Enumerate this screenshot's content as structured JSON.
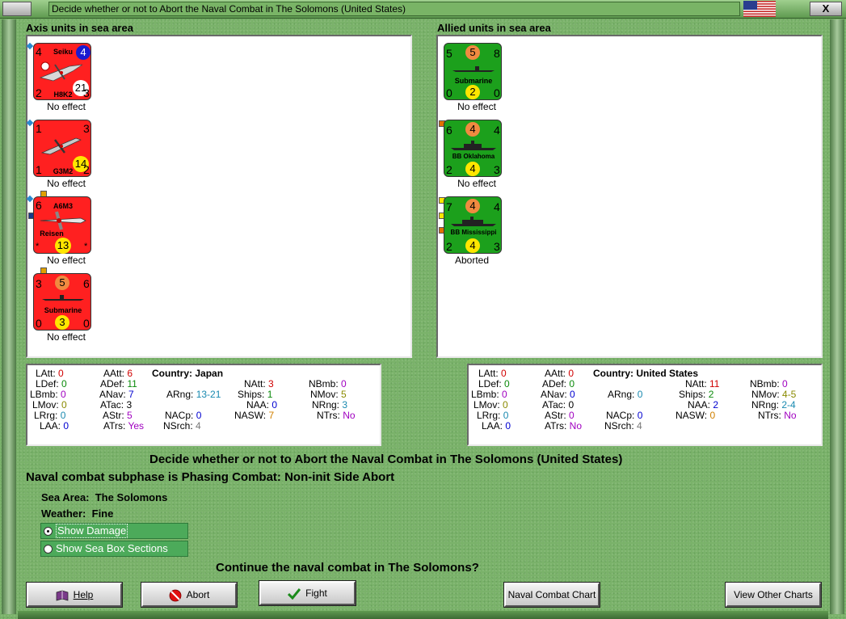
{
  "window": {
    "title": "Decide whether or not to Abort the Naval Combat in The Solomons (United States)",
    "close_label": "X",
    "flag": "us-flag-icon"
  },
  "axis": {
    "label": "Axis units in sea area",
    "units": [
      {
        "name": "Seiku",
        "model": "H8K2",
        "tl": "4",
        "tr": "4",
        "bl": "2",
        "br": "3",
        "val": "21",
        "caption": "No effect"
      },
      {
        "name": "",
        "model": "G3M2",
        "tl": "1",
        "tr": "3",
        "bl": "1",
        "br": "2",
        "val": "14",
        "caption": "No effect"
      },
      {
        "name": "A6M3",
        "model": "Reisen",
        "tl": "6",
        "tr": "",
        "bl": "*",
        "br": "*",
        "val": "13",
        "caption": "No effect"
      },
      {
        "name": "Submarine",
        "model": "",
        "tl": "3",
        "tm": "5",
        "tr": "6",
        "bl": "0",
        "bm": "3",
        "br": "0",
        "caption": "No effect"
      }
    ],
    "stats": {
      "LAtt": "0",
      "LDef": "0",
      "LBmb": "0",
      "LMov": "0",
      "LRrg": "0",
      "LAA": "0",
      "AAtt": "6",
      "ADef": "11",
      "ANav": "7",
      "ATac": "3",
      "AStr": "5",
      "ATrs": "Yes",
      "country_label": "Country:",
      "country": "Japan",
      "ARng": "13-21",
      "NACp": "0",
      "NSrch": "4",
      "NAtt": "3",
      "Ships": "1",
      "NAA": "0",
      "NASW": "7",
      "NBmb": "0",
      "NMov": "5",
      "NRng": "3",
      "NTrs": "No"
    }
  },
  "allied": {
    "label": "Allied units in sea area",
    "units": [
      {
        "name": "Submarine",
        "tl": "5",
        "tm": "5",
        "tr": "8",
        "bl": "0",
        "bm": "2",
        "br": "0",
        "caption": "No effect"
      },
      {
        "name": "BB Oklahoma",
        "tl": "6",
        "tm": "4",
        "tr": "4",
        "bl": "2",
        "bm": "4",
        "br": "3",
        "caption": "No effect"
      },
      {
        "name": "BB Mississippi",
        "tl": "7",
        "tm": "4",
        "tr": "4",
        "bl": "2",
        "bm": "4",
        "br": "3",
        "caption": "Aborted"
      }
    ],
    "stats": {
      "LAtt": "0",
      "LDef": "0",
      "LBmb": "0",
      "LMov": "0",
      "LRrg": "0",
      "LAA": "0",
      "AAtt": "0",
      "ADef": "0",
      "ANav": "0",
      "ATac": "0",
      "AStr": "0",
      "ATrs": "No",
      "country_label": "Country:",
      "country": "United States",
      "ARng": "0",
      "NACp": "0",
      "NSrch": "4",
      "NAtt": "11",
      "Ships": "2",
      "NAA": "2",
      "NASW": "0",
      "NBmb": "0",
      "NMov": "4-5",
      "NRng": "2-4",
      "NTrs": "No"
    }
  },
  "main": {
    "heading": "Decide whether or not to Abort the Naval Combat in The Solomons (United States)",
    "subphase": "Naval combat subphase is Phasing Combat: Non-init Side Abort",
    "sea_area_label": "Sea Area:",
    "sea_area": "The Solomons",
    "weather_label": "Weather:",
    "weather": "Fine",
    "show_damage": "Show Damage",
    "show_sea_box": "Show Sea Box Sections",
    "question": "Continue the naval combat in The Solomons?"
  },
  "buttons": {
    "help": "Help",
    "abort": "Abort",
    "fight": "Fight",
    "naval_chart": "Naval Combat Chart",
    "other_charts": "View Other Charts"
  }
}
